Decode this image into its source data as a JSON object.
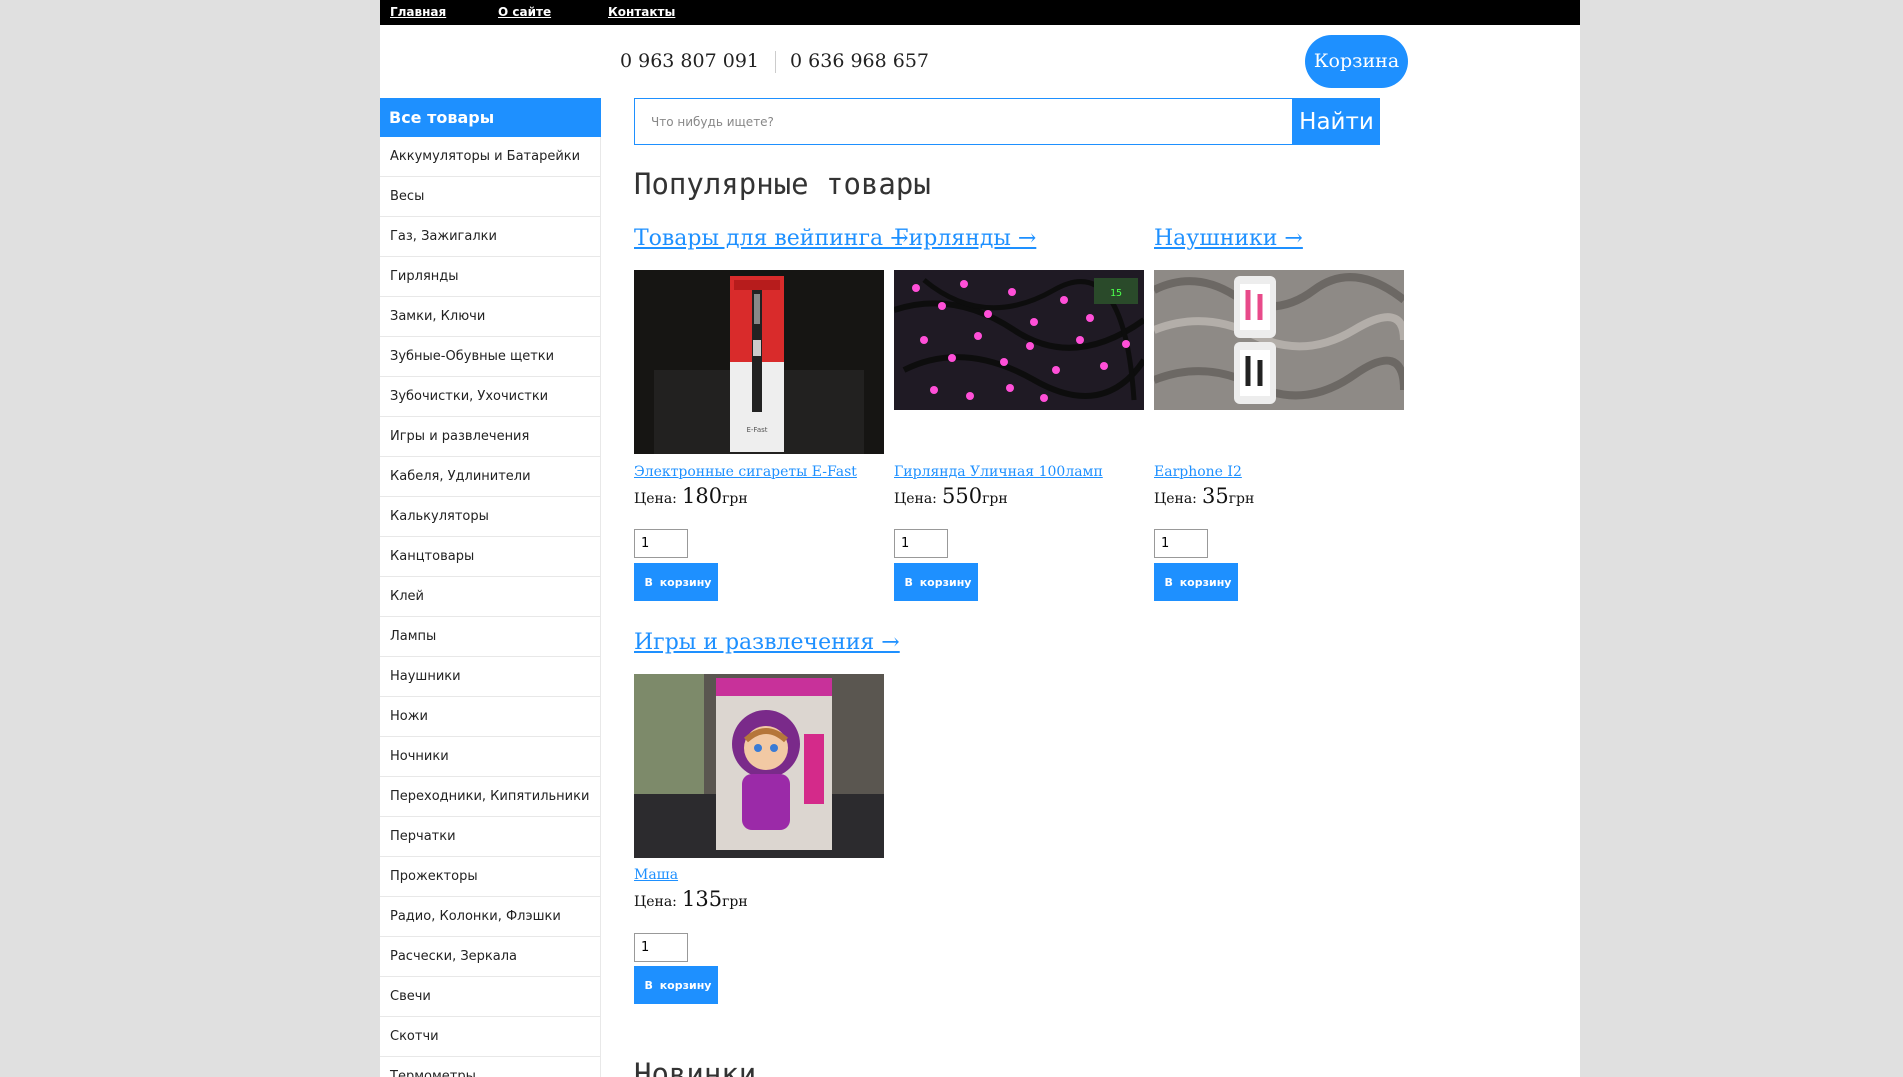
{
  "nav": {
    "links": [
      "Главная",
      "О сайте",
      "Контакты"
    ]
  },
  "header": {
    "phone_1": "0 963 807 091",
    "phone_2": "0 636 968 657",
    "cart_label": "Корзина"
  },
  "sidebar": {
    "title": "Все товары",
    "items": [
      "Аккумуляторы и Батарейки",
      "Весы",
      "Газ, Зажигалки",
      "Гирлянды",
      "Замки, Ключи",
      "Зубные-Обувные щетки",
      "Зубочистки, Ухочистки",
      "Игры и развлечения",
      "Кабеля, Удлинители",
      "Калькуляторы",
      "Канцтовары",
      "Клей",
      "Лампы",
      "Наушники",
      "Ножи",
      "Ночники",
      "Переходники, Кипятильники",
      "Перчатки",
      "Прожекторы",
      "Радио, Колонки, Флэшки",
      "Расчески, Зеркала",
      "Свечи",
      "Скотчи",
      "Термометры"
    ]
  },
  "search": {
    "placeholder": "Что нибудь ищете?",
    "button_label": "Найти"
  },
  "popular": {
    "title": "Популярные товары",
    "price_label": "Цена:",
    "currency": "грн",
    "add_label": "В корзину",
    "categories": [
      {
        "category": "Товары для вейпинга →",
        "product": "Электронные сигареты E-Fast",
        "price": "180",
        "qty": "1",
        "image": "e-cigarette-photo"
      },
      {
        "category": "Гирлянды →",
        "product": "Гирлянда Уличная 100ламп",
        "price": "550",
        "qty": "1",
        "image": "led-garland-photo"
      },
      {
        "category": "Наушники →",
        "product": "Earphone I2",
        "price": "35",
        "qty": "1",
        "image": "earphones-photo"
      },
      {
        "category": "Игры и развлечения →",
        "product": "Маша",
        "price": "135",
        "qty": "1",
        "image": "masha-doll-photo"
      }
    ]
  },
  "new_section": {
    "title": "Новинки"
  },
  "colors": {
    "accent": "#1e90ff",
    "topbar": "#000000",
    "background": "#e0e0e0"
  }
}
